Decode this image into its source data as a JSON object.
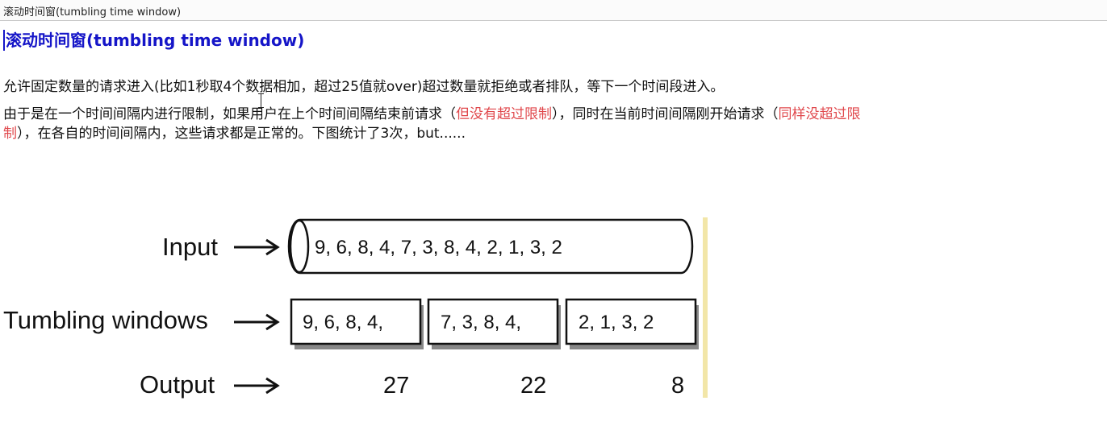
{
  "tab": {
    "title": "滚动时间窗(tumbling time window)"
  },
  "heading": "滚动时间窗(tumbling time window)",
  "paragraphs": {
    "p1": "允许固定数量的请求进入(比如1秒取4个数据相加，超过25值就over)超过数量就拒绝或者排队，等下一个时间段进入。",
    "p2_part1": "由于是在一个时间间隔内进行限制，如果用户在上个时间间隔结束前请求（",
    "p2_red1": "但没有超过限制",
    "p2_part2": "），同时在当前时间间隔刚开始请求（",
    "p2_red2a": "同样没超过限",
    "p2_red2b": "制",
    "p2_part3": "），在各自的时间间隔内，这些请求都是正常的。下图统计了3次，but......"
  },
  "figure": {
    "input_label": "Input",
    "input_values": "9,  6,  8,  4,  7,  3,  8,  4,  2,  1,  3,  2",
    "windows_label": "Tumbling windows",
    "windows": [
      "9,  6,  8,  4,",
      "7,  3,  8,  4,",
      "2,  1,  3,  2"
    ],
    "output_label": "Output",
    "outputs": [
      "27",
      "22",
      "8"
    ],
    "arrow_glyph": "→",
    "colors": {
      "accent_bar": "#f2e6a8",
      "heading": "#1515c8",
      "highlight": "#e0484c"
    }
  }
}
